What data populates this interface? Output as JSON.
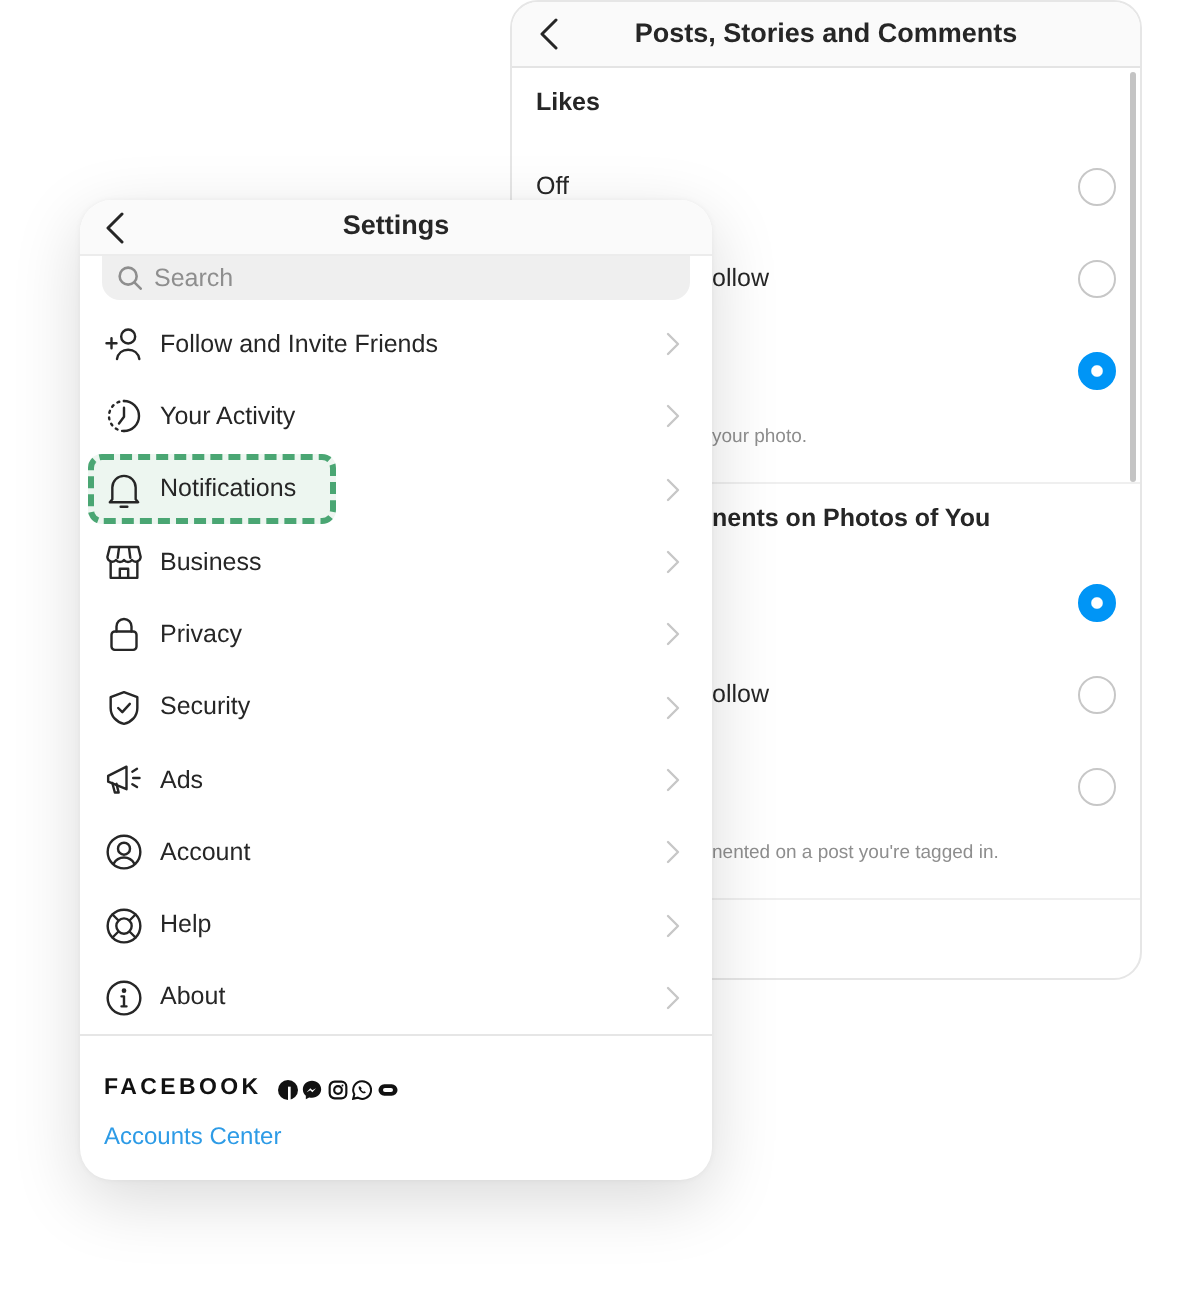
{
  "back_window": {
    "title": "Posts, Stories and Comments",
    "sections": [
      {
        "heading": "Likes",
        "options": [
          {
            "label": "Off",
            "selected": false
          },
          {
            "label": "ollow",
            "selected": false
          },
          {
            "selected": true
          }
        ],
        "caption": "your photo."
      },
      {
        "heading": "nents on Photos of You",
        "options": [
          {
            "selected": true
          },
          {
            "label": "ollow",
            "selected": false
          },
          {
            "selected": false
          }
        ],
        "caption": "nented on a post you're tagged in."
      }
    ]
  },
  "settings_window": {
    "title": "Settings",
    "search": {
      "placeholder": "Search"
    },
    "items": [
      {
        "label": "Follow and Invite Friends",
        "highlighted": false
      },
      {
        "label": "Your Activity",
        "highlighted": false
      },
      {
        "label": "Notifications",
        "highlighted": true
      },
      {
        "label": "Business",
        "highlighted": false
      },
      {
        "label": "Privacy",
        "highlighted": false
      },
      {
        "label": "Security",
        "highlighted": false
      },
      {
        "label": "Ads",
        "highlighted": false
      },
      {
        "label": "Account",
        "highlighted": false
      },
      {
        "label": "Help",
        "highlighted": false
      },
      {
        "label": "About",
        "highlighted": false
      }
    ],
    "footer": {
      "brand": "FACEBOOK",
      "link": "Accounts Center"
    }
  }
}
